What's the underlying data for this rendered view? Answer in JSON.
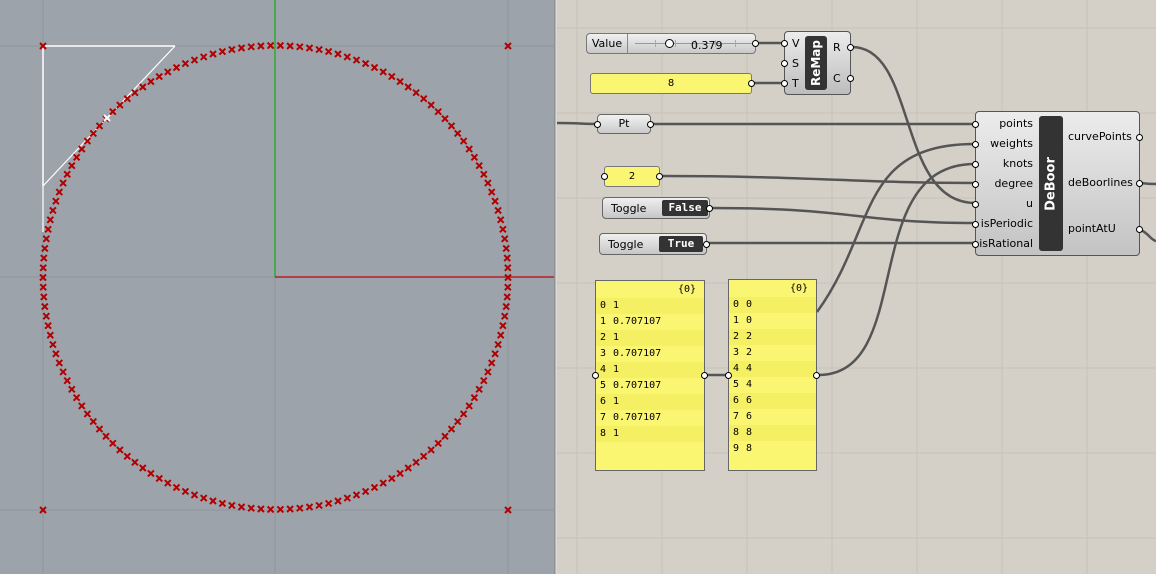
{
  "viewport": {
    "axis_colors": {
      "y_axis": "#2faa2f",
      "x_axis": "#b22222"
    },
    "point_color": "#b00000",
    "background": "#9da3ab"
  },
  "slider": {
    "name": "Value",
    "value": "0.379",
    "fraction": 0.379
  },
  "remap": {
    "title": "ReMap",
    "inputs": [
      "V",
      "S",
      "T"
    ],
    "outputs": [
      "R",
      "C"
    ]
  },
  "number_panel": {
    "value": "8"
  },
  "pt": {
    "label": "Pt"
  },
  "degree_panel": {
    "value": "2"
  },
  "toggle_periodic": {
    "name": "Toggle",
    "value": "False"
  },
  "toggle_rational": {
    "name": "Toggle",
    "value": "True"
  },
  "deboor": {
    "title": "DeBoor",
    "inputs": [
      "points",
      "weights",
      "knots",
      "degree",
      "u",
      "isPeriodic",
      "isRational"
    ],
    "outputs": [
      "curvePoints",
      "deBoorlines",
      "pointAtU"
    ]
  },
  "weights_panel": {
    "header": "{0}",
    "rows": [
      {
        "i": "0",
        "v": "1"
      },
      {
        "i": "1",
        "v": "0.707107"
      },
      {
        "i": "2",
        "v": "1"
      },
      {
        "i": "3",
        "v": "0.707107"
      },
      {
        "i": "4",
        "v": "1"
      },
      {
        "i": "5",
        "v": "0.707107"
      },
      {
        "i": "6",
        "v": "1"
      },
      {
        "i": "7",
        "v": "0.707107"
      },
      {
        "i": "8",
        "v": "1"
      }
    ]
  },
  "knots_panel": {
    "header": "{0}",
    "rows": [
      {
        "i": "0",
        "v": "0"
      },
      {
        "i": "1",
        "v": "0"
      },
      {
        "i": "2",
        "v": "2"
      },
      {
        "i": "3",
        "v": "2"
      },
      {
        "i": "4",
        "v": "4"
      },
      {
        "i": "5",
        "v": "4"
      },
      {
        "i": "6",
        "v": "6"
      },
      {
        "i": "7",
        "v": "6"
      },
      {
        "i": "8",
        "v": "8"
      },
      {
        "i": "9",
        "v": "8"
      }
    ]
  }
}
